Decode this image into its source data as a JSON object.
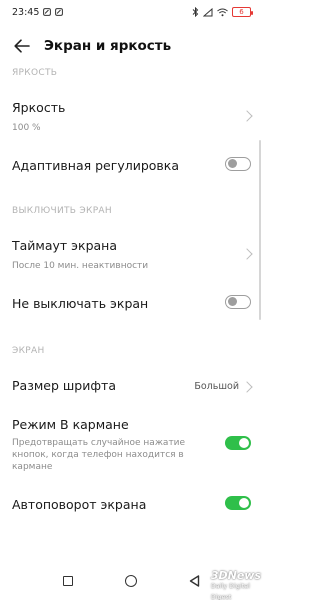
{
  "status_bar": {
    "time": "23:45",
    "battery": "6"
  },
  "header": {
    "title": "Экран и яркость"
  },
  "sections": {
    "brightness": "ЯРКОСТЬ",
    "screen_off": "ВЫКЛЮЧИТЬ ЭКРАН",
    "screen": "ЭКРАН"
  },
  "rows": {
    "brightness": {
      "label": "Яркость",
      "value": "100 %"
    },
    "adaptive": {
      "label": "Адаптивная регулировка",
      "toggle": false
    },
    "timeout": {
      "label": "Таймаут экрана",
      "value": "После 10 мин. неактивности"
    },
    "keep_on": {
      "label": "Не выключать экран",
      "toggle": false
    },
    "font_size": {
      "label": "Размер шрифта",
      "value": "Большой"
    },
    "pocket": {
      "label": "Режим В кармане",
      "description": "Предотвращать случайное нажатие кнопок, когда телефон находится в кармане",
      "toggle": true
    },
    "autorotate": {
      "label": "Автоповорот экрана",
      "toggle": true
    }
  },
  "watermark": {
    "line1": "3DNews",
    "line2": "Daily Digital Digest"
  },
  "colors": {
    "accent_on": "#2fbf4a",
    "battery_low": "#e53935"
  }
}
